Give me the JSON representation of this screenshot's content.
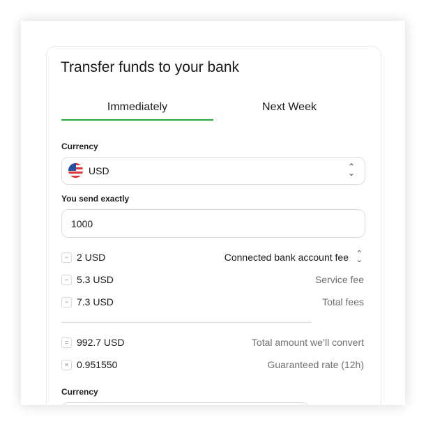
{
  "title": "Transfer funds to your bank",
  "tabs": [
    {
      "label": "Immediately",
      "active": true
    },
    {
      "label": "Next Week",
      "active": false
    }
  ],
  "accent_color": "#27a844",
  "currency_field": {
    "label": "Currency",
    "value": "USD",
    "flag_icon": "us-flag-icon",
    "chevron_icon": "chevron-up-down-icon"
  },
  "send_field": {
    "label": "You send exactly",
    "value": "1000"
  },
  "fees": [
    {
      "op": "−",
      "op_icon": "minus-icon",
      "value": "2 USD",
      "desc": "Connected bank account fee"
    },
    {
      "op": "−",
      "op_icon": "minus-icon",
      "value": "5.3 USD",
      "desc": "Service fee"
    },
    {
      "op": "−",
      "op_icon": "minus-icon",
      "value": "7.3 USD",
      "desc": "Total fees"
    }
  ],
  "totals": [
    {
      "op": "=",
      "op_icon": "equals-icon",
      "value": "992.7 USD",
      "desc": "Total amount we’ll convert"
    },
    {
      "op": "×",
      "op_icon": "multiply-icon",
      "value": "0.951550",
      "desc": "Guaranteed rate (12h)"
    }
  ],
  "currency_field_2": {
    "label": "Currency"
  }
}
